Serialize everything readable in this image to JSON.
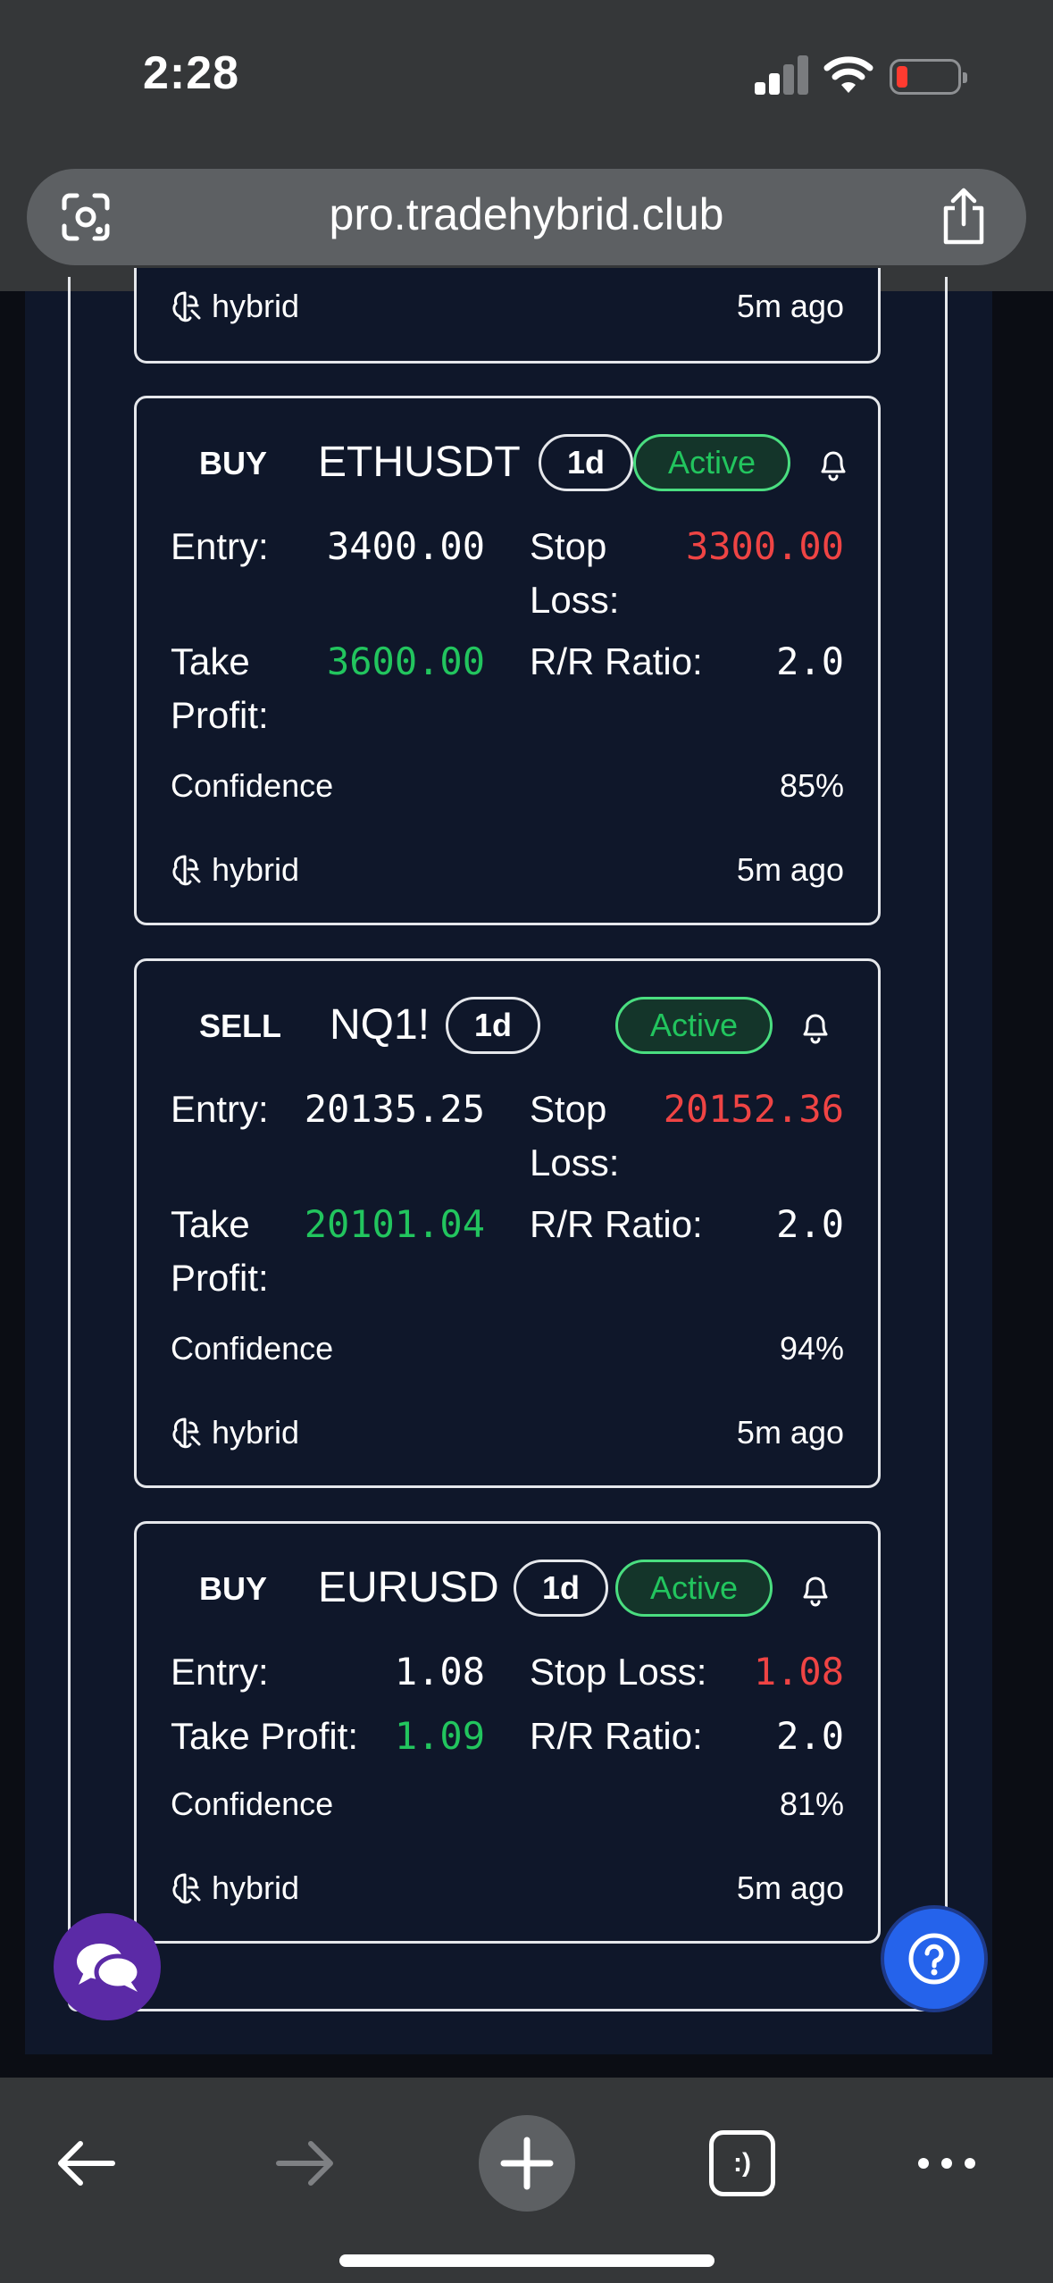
{
  "status_bar": {
    "time": "2:28"
  },
  "browser": {
    "url": "pro.tradehybrid.club"
  },
  "previous_card": {
    "source": "hybrid",
    "time_ago": "5m ago"
  },
  "signals": [
    {
      "direction": "BUY",
      "symbol": "ETHUSDT",
      "timeframe": "1d",
      "status": "Active",
      "entry_label": "Entry:",
      "entry": "3400.00",
      "stop_label_1": "Stop",
      "stop_label_2": "Loss:",
      "stop_loss": "3300.00",
      "tp_label_1": "Take",
      "tp_label_2": "Profit:",
      "take_profit": "3600.00",
      "rr_label": "R/R Ratio:",
      "rr": "2.0",
      "confidence_label": "Confidence",
      "confidence": "85%",
      "source": "hybrid",
      "time_ago": "5m ago"
    },
    {
      "direction": "SELL",
      "symbol": "NQ1!",
      "timeframe": "1d",
      "status": "Active",
      "entry_label": "Entry:",
      "entry": "20135.25",
      "stop_label_1": "Stop",
      "stop_label_2": "Loss:",
      "stop_loss": "20152.36",
      "tp_label_1": "Take",
      "tp_label_2": "Profit:",
      "take_profit": "20101.04",
      "rr_label": "R/R Ratio:",
      "rr": "2.0",
      "confidence_label": "Confidence",
      "confidence": "94%",
      "source": "hybrid",
      "time_ago": "5m ago"
    },
    {
      "direction": "BUY",
      "symbol": "EURUSD",
      "timeframe": "1d",
      "status": "Active",
      "entry_label": "Entry:",
      "entry": "1.08",
      "stop_label": "Stop Loss:",
      "stop_loss": "1.08",
      "tp_label": "Take Profit:",
      "take_profit": "1.09",
      "rr_label": "R/R Ratio:",
      "rr": "2.0",
      "confidence_label": "Confidence",
      "confidence": "81%",
      "source": "hybrid",
      "time_ago": "5m ago"
    }
  ],
  "colors": {
    "page_bg": "#0f172a",
    "profit_green": "#22c55e",
    "loss_red": "#ef4444",
    "chat_purple": "#5b2aa6",
    "help_blue": "#2563eb"
  },
  "icons": [
    "google-lens-icon",
    "share-icon",
    "bell-icon",
    "brain-icon",
    "chat-icon",
    "help-icon",
    "back-icon",
    "forward-icon",
    "new-tab-icon",
    "tabs-icon",
    "more-icon"
  ],
  "toolbar": {
    "tabs_label": ":)"
  }
}
